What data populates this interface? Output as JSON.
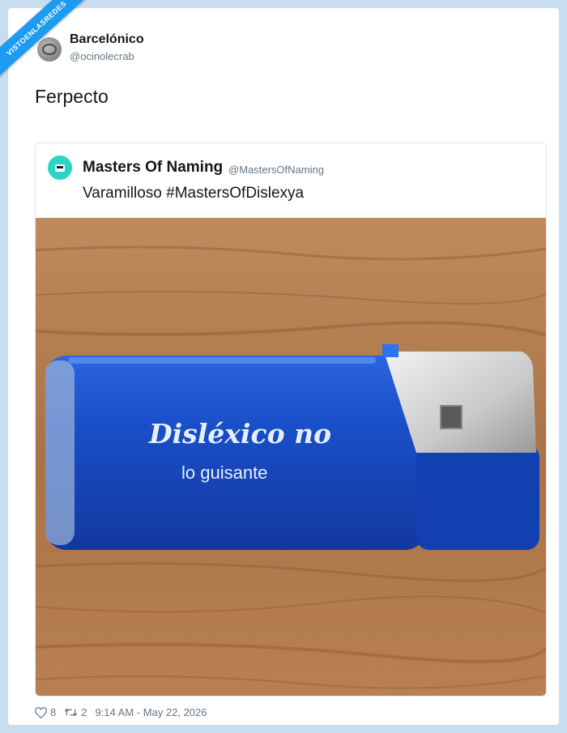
{
  "watermark": "VISTOENLASREDES",
  "author": {
    "name": "Barcelónico",
    "handle": "@ocinolecrab"
  },
  "tweet": {
    "text": "Ferpecto"
  },
  "quoted": {
    "name": "Masters Of Naming",
    "handle": "@MastersOfNaming",
    "text": "Varamilloso #MastersOfDislexya",
    "image": {
      "lighter_text_line1": "Disléxico no",
      "lighter_text_line2": "lo guisante"
    }
  },
  "footer": {
    "likes": "8",
    "retweets": "2",
    "timestamp": "9:14 AM - May 22, 2026"
  },
  "colors": {
    "accent": "#1d9bf0",
    "lighter_blue": "#1746c0",
    "wood": "#b07a4d"
  },
  "icons": {
    "like": "heart-icon",
    "retweet": "retweet-icon"
  }
}
